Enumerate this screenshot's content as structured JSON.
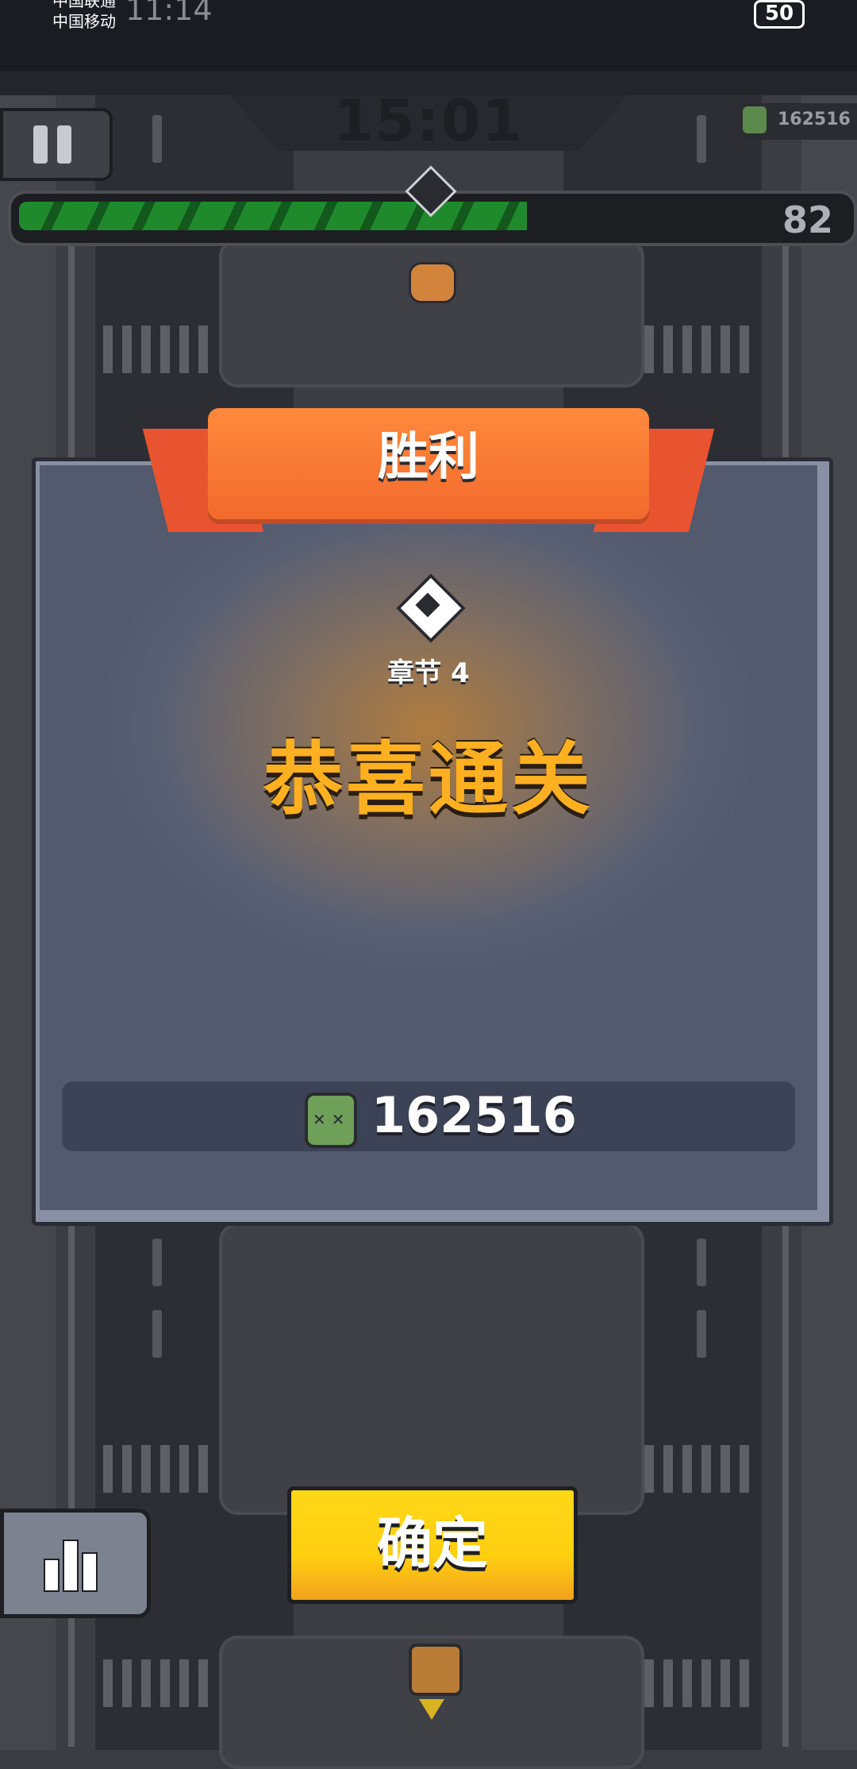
{
  "status_bar": {
    "carrier_1": "中国联通",
    "carrier_2": "中国移动",
    "time": "11:14",
    "battery": "50"
  },
  "hud": {
    "timer": "15:01",
    "score_total": "162516",
    "progress_count": "82",
    "progress_fraction": 0.64
  },
  "result_dialog": {
    "title": "胜利",
    "chapter_label": "章节 4",
    "headline": "恭喜通关",
    "score": "162516"
  },
  "buttons": {
    "confirm_label": "确定"
  },
  "colors": {
    "ribbon": "#f26a2c",
    "headline": "#ffb020",
    "confirm": "#ffcf10",
    "progress": "#1f8a2c"
  },
  "icons": [
    "pause-icon",
    "zombie-icon",
    "chapter-diamond-icon",
    "stats-icon",
    "chest-icon",
    "player-icon"
  ]
}
